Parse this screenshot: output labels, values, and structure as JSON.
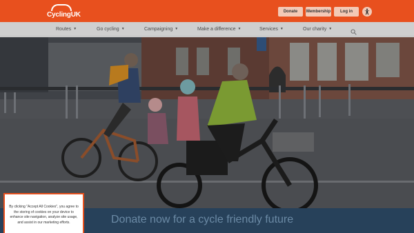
{
  "header": {
    "logo_text": "CyclingUK",
    "buttons": {
      "donate": "Donate",
      "membership": "Membership",
      "login": "Log in"
    },
    "accessibility_icon": "accessibility-icon"
  },
  "nav": {
    "items": [
      {
        "label": "Routes"
      },
      {
        "label": "Go cycling"
      },
      {
        "label": "Campaigning"
      },
      {
        "label": "Make a difference"
      },
      {
        "label": "Services"
      },
      {
        "label": "Our charity"
      }
    ],
    "search_icon": "search-icon"
  },
  "hero": {
    "image_description_icon": "hero-photo"
  },
  "banner": {
    "title": "Donate now for a cycle friendly future"
  },
  "cookie": {
    "text": "By clicking \"Accept All Cookies\", you agree to the storing of cookies on your device to enhance site navigation, analyze site usage, and assist in our marketing efforts."
  },
  "colors": {
    "brand_orange": "#e8501e",
    "band_navy": "#27415a",
    "nav_bg": "#cfcfcf"
  }
}
